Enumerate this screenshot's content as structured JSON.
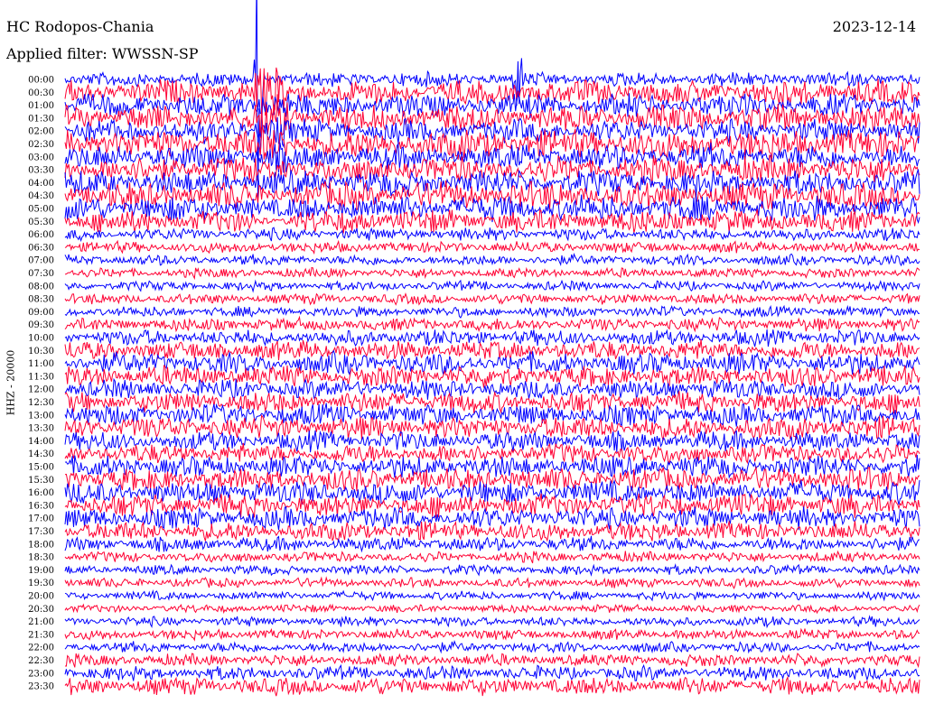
{
  "header": {
    "station": "HC Rodopos-Chania",
    "date": "2023-12-14",
    "filter": "Applied filter: WWSSN-SP"
  },
  "axis": {
    "channel_label": "HHZ - 20000"
  },
  "colors": {
    "trace_a": "#0000ff",
    "trace_b": "#ff0033",
    "background": "#ffffff"
  },
  "chart_data": {
    "type": "line",
    "title": "HC Rodopos-Chania",
    "subtitle": "Applied filter: WWSSN-SP",
    "ylabel": "HHZ - 20000",
    "row_labels": [
      "00:00",
      "00:30",
      "01:00",
      "01:30",
      "02:00",
      "02:30",
      "03:00",
      "03:30",
      "04:00",
      "04:30",
      "05:00",
      "05:30",
      "06:00",
      "06:30",
      "07:00",
      "07:30",
      "08:00",
      "08:30",
      "09:00",
      "09:30",
      "10:00",
      "10:30",
      "11:00",
      "11:30",
      "12:00",
      "12:30",
      "13:00",
      "13:30",
      "14:00",
      "14:30",
      "15:00",
      "15:30",
      "16:00",
      "16:30",
      "17:00",
      "17:30",
      "18:00",
      "18:30",
      "19:00",
      "19:30",
      "20:00",
      "20:30",
      "21:00",
      "21:30",
      "22:00",
      "22:30",
      "23:00",
      "23:30"
    ],
    "row_colors": [
      "#0000ff",
      "#ff0033"
    ],
    "relative_noise_amplitude": [
      0.8,
      1.4,
      1.3,
      1.5,
      1.3,
      1.7,
      1.4,
      1.5,
      1.4,
      1.6,
      1.5,
      1.3,
      0.7,
      0.65,
      0.6,
      0.55,
      0.55,
      0.6,
      0.6,
      0.75,
      0.9,
      1.1,
      1.2,
      1.2,
      1.1,
      1.2,
      1.2,
      1.3,
      1.1,
      1.1,
      1.2,
      1.3,
      1.3,
      1.3,
      1.2,
      1.1,
      0.8,
      0.6,
      0.55,
      0.55,
      0.5,
      0.45,
      0.55,
      0.6,
      0.6,
      0.7,
      0.8,
      1.0
    ],
    "events": [
      {
        "label": "large event",
        "row": "00:00",
        "minutes_into_row": 6.8,
        "peak_relative": 30
      },
      {
        "label": "spike",
        "row": "00:00",
        "minutes_into_row": 15.9,
        "peak_relative": 6
      }
    ],
    "grid": false,
    "legend": "none"
  }
}
